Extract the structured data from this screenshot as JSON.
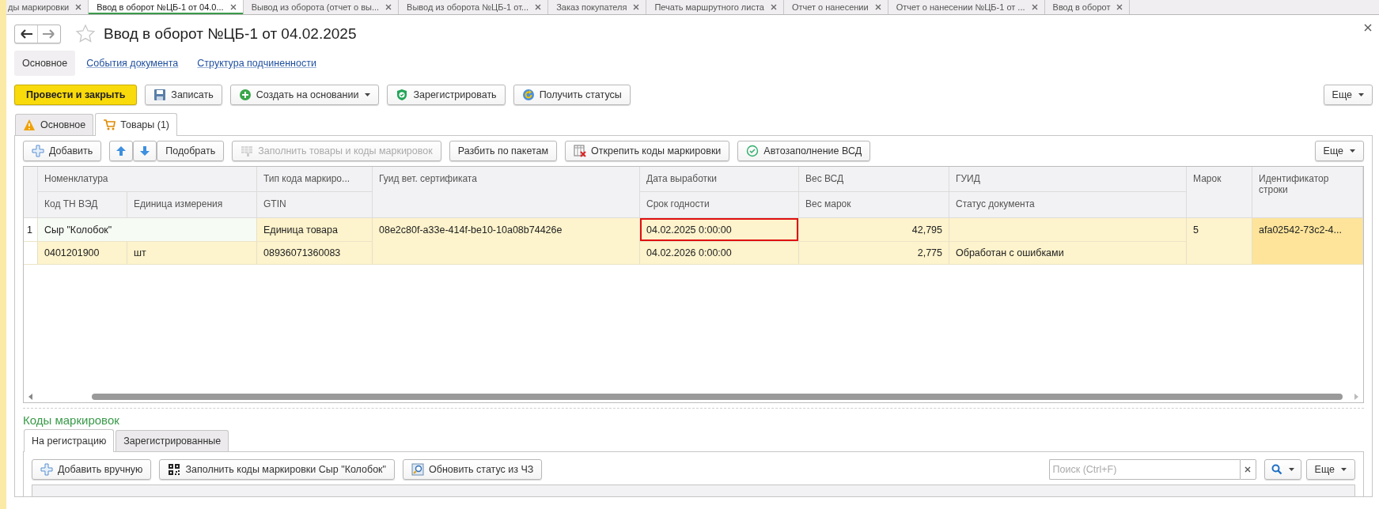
{
  "window_tabs": [
    {
      "label": "ды маркировки",
      "selected": false
    },
    {
      "label": "Ввод в оборот №ЦБ-1 от 04.0...",
      "selected": true
    },
    {
      "label": "Вывод из оборота (отчет о вы...",
      "selected": false
    },
    {
      "label": "Вывод из оборота №ЦБ-1 от...",
      "selected": false
    },
    {
      "label": "Заказ покупателя",
      "selected": false
    },
    {
      "label": "Печать маршрутного листа",
      "selected": false
    },
    {
      "label": "Отчет о нанесении",
      "selected": false
    },
    {
      "label": "Отчет о нанесении №ЦБ-1 от ...",
      "selected": false
    },
    {
      "label": "Ввод в оборот",
      "selected": false
    }
  ],
  "title": "Ввод в оборот №ЦБ-1 от 04.02.2025",
  "nav": [
    {
      "label": "Основное",
      "selected": true
    },
    {
      "label": "События документа",
      "selected": false
    },
    {
      "label": "Структура подчиненности",
      "selected": false
    }
  ],
  "toolbar": {
    "buttons": [
      {
        "label": "Провести и закрыть",
        "kind": "primary",
        "dropdown": false
      },
      {
        "label": "Записать",
        "kind": "save",
        "dropdown": false
      },
      {
        "label": "Создать на основании",
        "kind": "plus-circle",
        "dropdown": true
      },
      {
        "label": "Зарегистрировать",
        "kind": "shield",
        "dropdown": false
      },
      {
        "label": "Получить статусы",
        "kind": "refresh",
        "dropdown": false
      }
    ],
    "more": "Еще"
  },
  "form_tabs": [
    {
      "label": "Основное",
      "kind": "warning",
      "selected": false
    },
    {
      "label": "Товары (1)",
      "kind": "cart",
      "selected": true
    }
  ],
  "goods_toolbar": {
    "buttons": [
      {
        "label": "Добавить",
        "kind": "plus",
        "disabled": false
      },
      {
        "kind": "arrow-up",
        "disabled": false
      },
      {
        "kind": "arrow-down",
        "disabled": false
      },
      {
        "label": "Подобрать",
        "kind": "plain",
        "disabled": false
      },
      {
        "label": "Заполнить товары и коды маркировок",
        "kind": "grid",
        "disabled": true
      },
      {
        "label": "Разбить по пакетам",
        "kind": "plain",
        "disabled": false
      },
      {
        "label": "Открепить коды маркировки",
        "kind": "unpin",
        "disabled": false
      },
      {
        "label": "Автозаполнение ВСД",
        "kind": "auto",
        "disabled": false
      }
    ],
    "more": "Еще"
  },
  "goods_table": {
    "header": {
      "nomenclature": "Номенклатура",
      "tn_ved": "Код ТН ВЭД",
      "unit": "Единица измерения",
      "code_type": "Тип кода маркиро...",
      "gtin": "GTIN",
      "vet_guid": "Гуид вет. сертификата",
      "production_date": "Дата выработки",
      "expiry": "Срок годности",
      "vsd_weight": "Вес ВСД",
      "marks_weight": "Вес марок",
      "guid": "ГУИД",
      "doc_status": "Статус документа",
      "marks": "Марок",
      "row_id": "Идентификатор строки"
    },
    "rows": [
      {
        "number": "1",
        "nomenclature": "Сыр \"Колобок\"",
        "tn_ved": "0401201900",
        "unit": "шт",
        "code_type": "Единица товара",
        "gtin": "08936071360083",
        "vet_guid": "08e2c80f-a33e-414f-be10-10a08b74426e",
        "production_date": "04.02.2025 0:00:00",
        "highlighted": true,
        "expiry": "04.02.2026 0:00:00",
        "vsd_weight": "42,795",
        "marks_weight": "2,775",
        "doc_status": "Обработан с ошибками",
        "marks": "5",
        "row_id": "afa02542-73c2-4...",
        "selected": true
      }
    ]
  },
  "codes": {
    "title": "Коды маркировок",
    "tabs": [
      {
        "label": "На регистрацию",
        "selected": true
      },
      {
        "label": "Зарегистрированные",
        "selected": false
      }
    ],
    "buttons": [
      {
        "label": "Добавить вручную",
        "kind": "plus"
      },
      {
        "label": "Заполнить коды маркировки Сыр \"Колобок\"",
        "kind": "qr"
      },
      {
        "label": "Обновить статус из ЧЗ",
        "kind": "status"
      }
    ],
    "search": {
      "placeholder": "Поиск (Ctrl+F)"
    },
    "more": "Еще"
  }
}
